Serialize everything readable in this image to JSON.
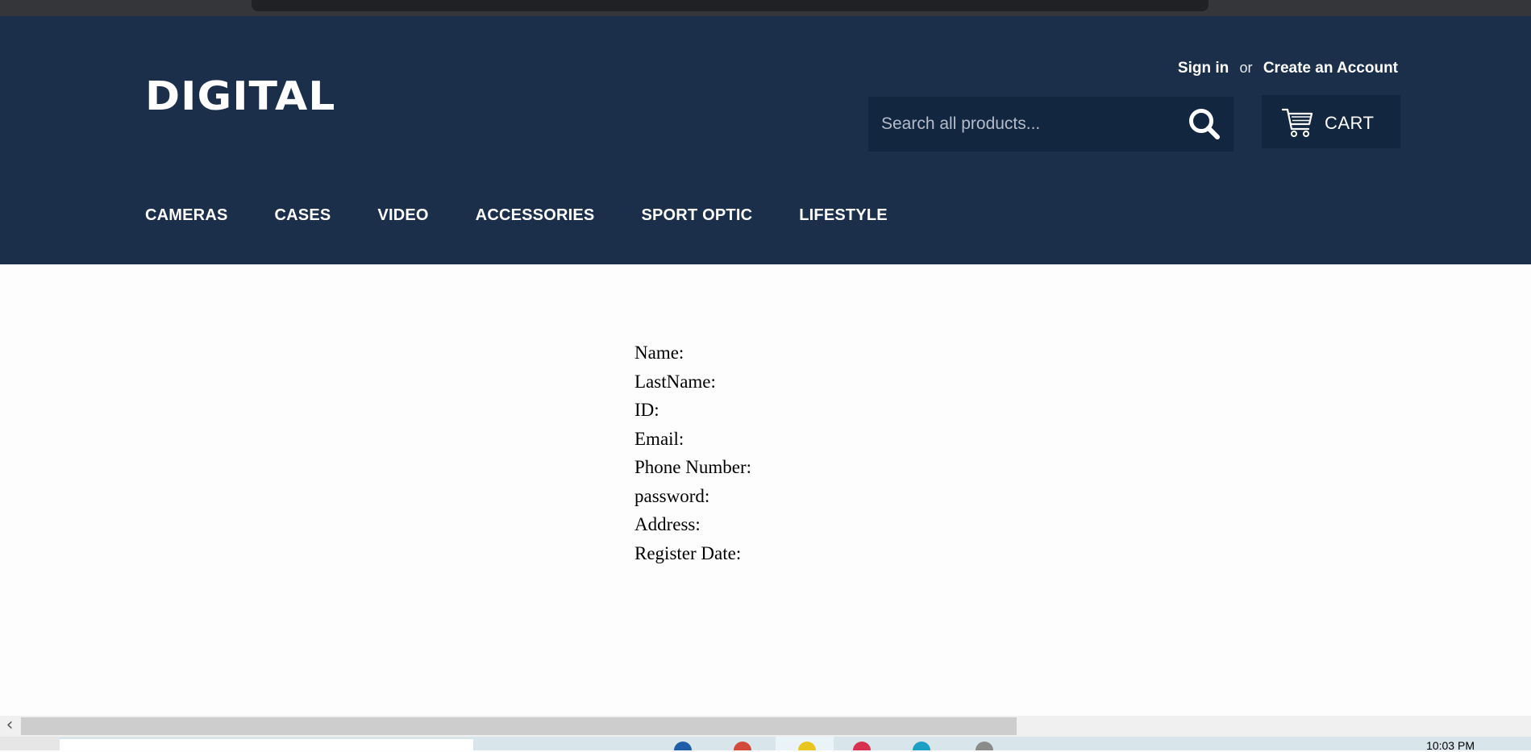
{
  "brand": {
    "logo": "DIGITAL"
  },
  "account": {
    "sign_in": "Sign in",
    "or": "or",
    "create_account": "Create an Account"
  },
  "search": {
    "placeholder": "Search all products..."
  },
  "cart": {
    "label": "CART"
  },
  "nav": {
    "items": [
      {
        "label": "CAMERAS"
      },
      {
        "label": "CASES"
      },
      {
        "label": "VIDEO"
      },
      {
        "label": "ACCESSORIES"
      },
      {
        "label": "SPORT OPTIC"
      },
      {
        "label": "LIFESTYLE"
      }
    ]
  },
  "profile": {
    "fields": [
      {
        "label": "Name:"
      },
      {
        "label": "LastName:"
      },
      {
        "label": "ID:"
      },
      {
        "label": "Email:"
      },
      {
        "label": "Phone Number:"
      },
      {
        "label": "password:"
      },
      {
        "label": "Address:"
      },
      {
        "label": "Register Date:"
      }
    ]
  },
  "taskbar": {
    "clock": "10:03 PM"
  },
  "colors": {
    "header_bg": "#1b2f4b",
    "control_bg": "#132640",
    "page_bg": "#fdfdfd"
  },
  "icons": {
    "search": "search-icon",
    "cart": "cart-icon",
    "scroll_left": "chevron-left-icon"
  }
}
